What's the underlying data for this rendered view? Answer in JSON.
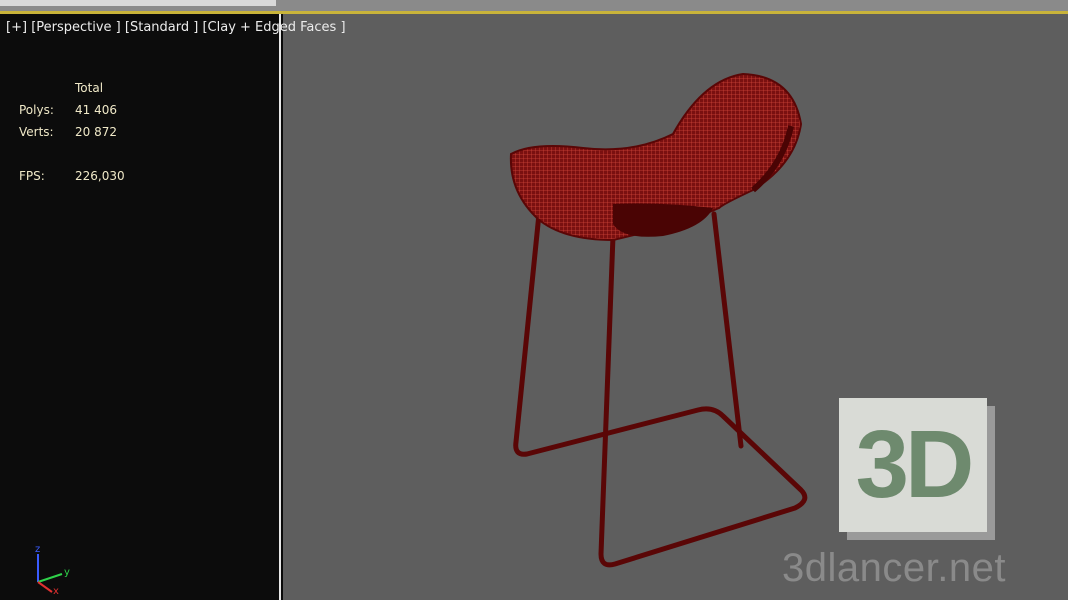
{
  "viewport": {
    "labels": [
      "[+]",
      "[Perspective ]",
      "[Standard ]",
      "[Clay + Edged Faces ]"
    ]
  },
  "stats": {
    "header": "Total",
    "polys_label": "Polys:",
    "polys_value": "41 406",
    "verts_label": "Verts:",
    "verts_value": "20 872",
    "fps_label": "FPS:",
    "fps_value": "226,030"
  },
  "axis": {
    "z": "z",
    "y": "y",
    "x": "x"
  },
  "watermark": {
    "logo": "3D",
    "url": "3dlancer.net"
  },
  "colors": {
    "viewport_bg": "#5e5e5e",
    "model": "#6a0a0a",
    "mesh": "#c23a30",
    "stats_text": "#f0e9c8"
  }
}
